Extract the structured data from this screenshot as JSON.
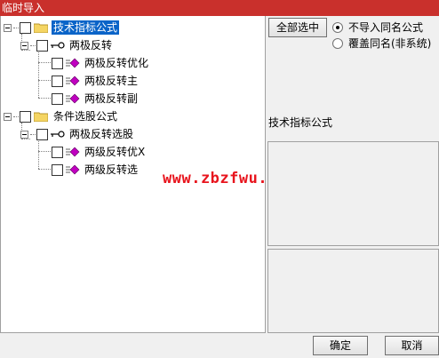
{
  "window": {
    "title": "临时导入"
  },
  "tree": {
    "groups": [
      {
        "label": "技术指标公式",
        "subgroup": "两极反转",
        "items": [
          "两极反转优化",
          "两极反转主",
          "两极反转副"
        ]
      },
      {
        "label": "条件选股公式",
        "subgroup": "两极反转选股",
        "items": [
          "两级反转优X",
          "两级反转选"
        ]
      }
    ]
  },
  "watermark": "www.zbzfwu.com",
  "options": {
    "select_all_label": "全部选中",
    "radio_skip_label": "不导入同名公式",
    "radio_overwrite_label": "覆盖同名(非系统)",
    "selected": "skip"
  },
  "description": {
    "title": "技术指标公式"
  },
  "footer": {
    "ok_label": "确定",
    "cancel_label": "取消"
  },
  "colors": {
    "titlebar": "#c9302c",
    "selection": "#0a64c8",
    "watermark": "#e8141d",
    "formula_icon": "#c000c0"
  }
}
